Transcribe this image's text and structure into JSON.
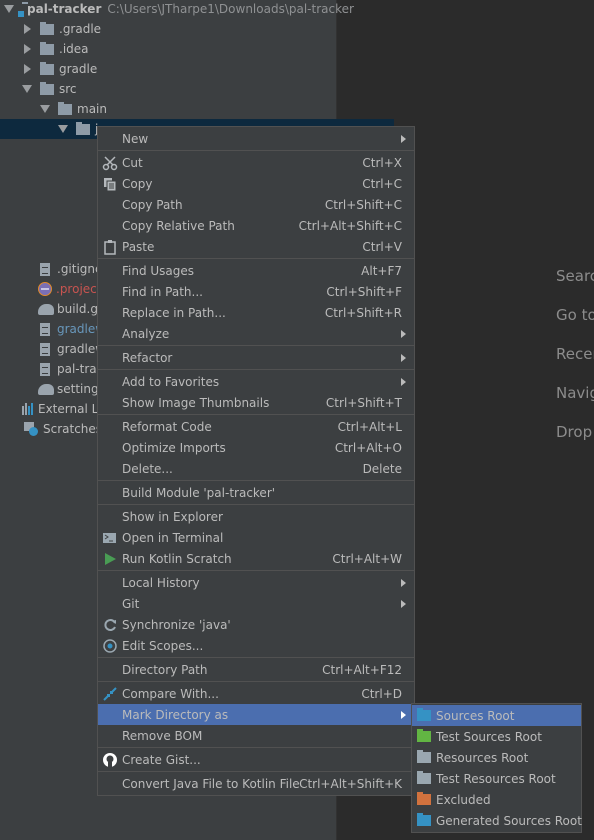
{
  "tree": {
    "root": {
      "label": "pal-tracker",
      "path": "C:\\Users\\JTharpe1\\Downloads\\pal-tracker"
    },
    "items": [
      {
        "label": ".gradle",
        "icon": "folder-icon",
        "expanded": false
      },
      {
        "label": ".idea",
        "icon": "folder-icon",
        "expanded": false
      },
      {
        "label": "gradle",
        "icon": "folder-icon",
        "expanded": false
      },
      {
        "label": "src",
        "icon": "folder-icon",
        "expanded": true
      },
      {
        "label": "main",
        "icon": "folder-icon",
        "expanded": true
      },
      {
        "label": "j",
        "icon": "folder-icon",
        "expanded": true,
        "selected": true
      },
      {
        "label": ".gitignc",
        "icon": "file-icon"
      },
      {
        "label": ".project",
        "icon": "eclipse-icon"
      },
      {
        "label": "build.g",
        "icon": "gradle-icon"
      },
      {
        "label": "gradlew",
        "icon": "file-icon"
      },
      {
        "label": "gradlew",
        "icon": "file-icon"
      },
      {
        "label": "pal-trac",
        "icon": "file-icon"
      },
      {
        "label": "settings",
        "icon": "gradle-icon"
      },
      {
        "label": "External Lib",
        "icon": "library-icon"
      },
      {
        "label": "Scratches a",
        "icon": "scratches-icon"
      }
    ]
  },
  "hints": [
    "Search",
    "Go to",
    "Recent",
    "Navig",
    "Drop"
  ],
  "context_menu": {
    "items": [
      {
        "label": "New",
        "submenu": true
      },
      {
        "sep": true
      },
      {
        "label": "Cut",
        "shortcut": "Ctrl+X",
        "icon": "cut-icon"
      },
      {
        "label": "Copy",
        "shortcut": "Ctrl+C",
        "icon": "copy-icon"
      },
      {
        "label": "Copy Path",
        "shortcut": "Ctrl+Shift+C"
      },
      {
        "label": "Copy Relative Path",
        "shortcut": "Ctrl+Alt+Shift+C"
      },
      {
        "label": "Paste",
        "shortcut": "Ctrl+V",
        "icon": "paste-icon"
      },
      {
        "sep": true
      },
      {
        "label": "Find Usages",
        "shortcut": "Alt+F7"
      },
      {
        "label": "Find in Path...",
        "shortcut": "Ctrl+Shift+F"
      },
      {
        "label": "Replace in Path...",
        "shortcut": "Ctrl+Shift+R"
      },
      {
        "label": "Analyze",
        "submenu": true
      },
      {
        "sep": true
      },
      {
        "label": "Refactor",
        "submenu": true
      },
      {
        "sep": true
      },
      {
        "label": "Add to Favorites",
        "submenu": true
      },
      {
        "label": "Show Image Thumbnails",
        "shortcut": "Ctrl+Shift+T"
      },
      {
        "sep": true
      },
      {
        "label": "Reformat Code",
        "shortcut": "Ctrl+Alt+L"
      },
      {
        "label": "Optimize Imports",
        "shortcut": "Ctrl+Alt+O"
      },
      {
        "label": "Delete...",
        "shortcut": "Delete"
      },
      {
        "sep": true
      },
      {
        "label": "Build Module 'pal-tracker'"
      },
      {
        "sep": true
      },
      {
        "label": "Show in Explorer"
      },
      {
        "label": "Open in Terminal",
        "icon": "terminal-icon"
      },
      {
        "label": "Run Kotlin Scratch",
        "shortcut": "Ctrl+Alt+W",
        "icon": "run-icon"
      },
      {
        "sep": true
      },
      {
        "label": "Local History",
        "submenu": true
      },
      {
        "label": "Git",
        "submenu": true
      },
      {
        "label": "Synchronize 'java'",
        "icon": "sync-icon"
      },
      {
        "label": "Edit Scopes...",
        "icon": "scope-icon"
      },
      {
        "sep": true
      },
      {
        "label": "Directory Path",
        "shortcut": "Ctrl+Alt+F12"
      },
      {
        "sep": true
      },
      {
        "label": "Compare With...",
        "shortcut": "Ctrl+D",
        "icon": "compare-icon"
      },
      {
        "label": "Mark Directory as",
        "submenu": true,
        "highlighted": true
      },
      {
        "label": "Remove BOM"
      },
      {
        "sep": true
      },
      {
        "label": "Create Gist...",
        "icon": "github-icon"
      },
      {
        "sep": true
      },
      {
        "label": "Convert Java File to Kotlin File",
        "shortcut": "Ctrl+Alt+Shift+K"
      }
    ]
  },
  "submenu": {
    "items": [
      {
        "label": "Sources Root",
        "color": "#3592c4",
        "icon": "sources-root-icon",
        "highlighted": true
      },
      {
        "label": "Test Sources Root",
        "color": "#62b543",
        "icon": "test-sources-root-icon"
      },
      {
        "label": "Resources Root",
        "color": "#9aa7b0",
        "icon": "resources-root-icon"
      },
      {
        "label": "Test Resources Root",
        "color": "#9aa7b0",
        "icon": "test-resources-root-icon"
      },
      {
        "label": "Excluded",
        "color": "#d1723e",
        "icon": "excluded-icon"
      },
      {
        "label": "Generated Sources Root",
        "color": "#3592c4",
        "icon": "generated-sources-root-icon"
      }
    ]
  },
  "colors": {
    "selection": "#4b6eaf",
    "tree_selection": "#0d293e",
    "panel": "#3c3f41",
    "editor": "#2b2b2b"
  }
}
